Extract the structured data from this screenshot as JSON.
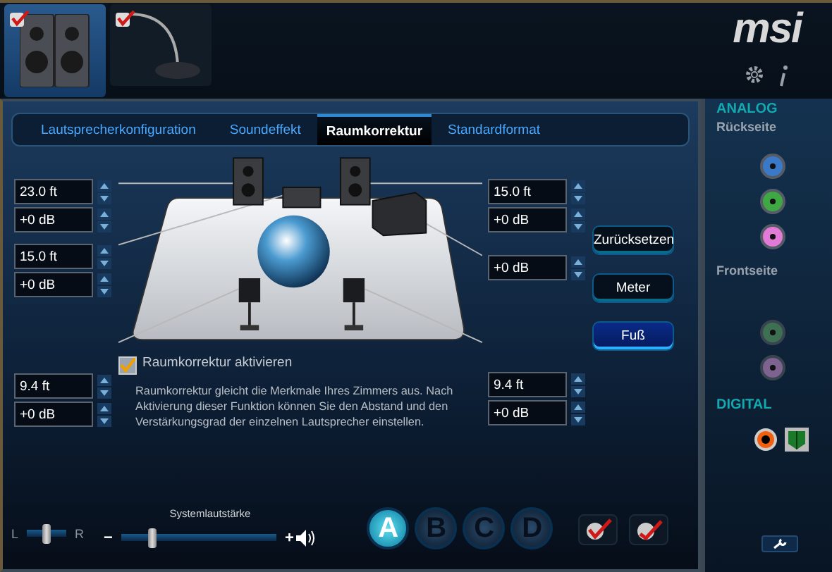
{
  "devices": [
    {
      "kind": "speakers",
      "selected": true,
      "checked": true
    },
    {
      "kind": "microphone",
      "selected": false,
      "checked": true
    }
  ],
  "logo": "msi",
  "tabs": [
    {
      "label": "Lautsprecherkonfiguration",
      "selected": false
    },
    {
      "label": "Soundeffekt",
      "selected": false
    },
    {
      "label": "Raumkorrektur",
      "selected": true
    },
    {
      "label": "Standardformat",
      "selected": false
    }
  ],
  "left_fields": [
    {
      "distance": "23.0 ft",
      "gain": "+0 dB"
    },
    {
      "distance": "15.0 ft",
      "gain": "+0 dB"
    },
    {
      "distance": "9.4 ft",
      "gain": "+0 dB"
    }
  ],
  "right_fields": [
    {
      "distance": "15.0 ft",
      "gain": "+0 dB"
    },
    {
      "gain": "+0 dB"
    },
    {
      "distance": "9.4 ft",
      "gain": "+0 dB"
    }
  ],
  "buttons": [
    {
      "label": "Zurücksetzen",
      "selected": false
    },
    {
      "label": "Meter",
      "selected": false
    },
    {
      "label": "Fuß",
      "selected": true
    }
  ],
  "room_correction": {
    "label": "Raumkorrektur aktivieren",
    "checked": true,
    "description": "Raumkorrektur gleicht die Merkmale Ihres Zimmers aus. Nach Aktivierung dieser Funktion können Sie den Abstand und den Verstärkungsgrad der einzelnen Lautsprecher einstellen."
  },
  "balance": {
    "left_label": "L",
    "right_label": "R",
    "level": 0.5
  },
  "volume": {
    "label": "Systemlautstärke",
    "minus": "−",
    "plus": "+",
    "level": 0.2
  },
  "profiles": [
    {
      "label": "A",
      "selected": true
    },
    {
      "label": "B",
      "selected": false
    },
    {
      "label": "C",
      "selected": false
    },
    {
      "label": "D",
      "selected": false
    }
  ],
  "sidebar": {
    "analog_title": "ANALOG",
    "back_label": "Rückseite",
    "back_jacks": [
      {
        "color": "#3a78c8"
      },
      {
        "color": "#3fa845"
      },
      {
        "color": "#e47ad8"
      }
    ],
    "front_label": "Frontseite",
    "front_jacks": [
      {
        "color": "#3d6f52"
      },
      {
        "color": "#7d6390"
      }
    ],
    "digital_title": "DIGITAL",
    "digital_jacks": [
      {
        "kind": "coaxial"
      },
      {
        "kind": "optical"
      }
    ]
  }
}
